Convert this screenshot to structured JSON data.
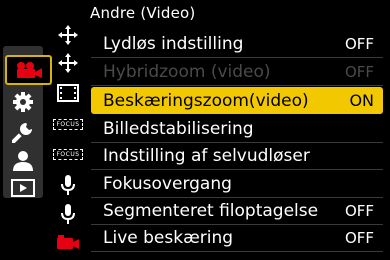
{
  "header": {
    "title": "Andre (Video)"
  },
  "main_tabs": [
    {
      "icon": "video-camera-icon",
      "active": true
    },
    {
      "icon": "gear-icon"
    },
    {
      "icon": "wrench-icon"
    },
    {
      "icon": "person-icon"
    },
    {
      "icon": "playback-icon"
    }
  ],
  "sub_tabs": [
    {
      "icon": "crosshair-arrows-icon"
    },
    {
      "icon": "crosshair-arrows-icon"
    },
    {
      "icon": "film-strip-icon"
    },
    {
      "icon": "focus-frame-icon",
      "label": "FOCUS"
    },
    {
      "icon": "focus-frame-icon",
      "label": "FOCUS"
    },
    {
      "icon": "microphone-icon"
    },
    {
      "icon": "microphone-icon"
    },
    {
      "icon": "red-camera-icon",
      "color": "#e60012"
    }
  ],
  "menu": {
    "items": [
      {
        "label": "Lydløs indstilling",
        "value": "OFF"
      },
      {
        "label": "Hybridzoom (video)",
        "value": "OFF",
        "disabled": true
      },
      {
        "label": "Beskæringszoom(video)",
        "value": "ON",
        "selected": true
      },
      {
        "label": "Billedstabilisering",
        "value": ""
      },
      {
        "label": "Indstilling af selvudløser",
        "value": ""
      },
      {
        "label": "Fokusovergang",
        "value": ""
      },
      {
        "label": "Segmenteret filoptagelse",
        "value": "OFF"
      },
      {
        "label": "Live beskæring",
        "value": "OFF"
      }
    ]
  },
  "colors": {
    "highlight": "#f2c800",
    "active_border": "#d9b400",
    "accent_red": "#e60012"
  }
}
